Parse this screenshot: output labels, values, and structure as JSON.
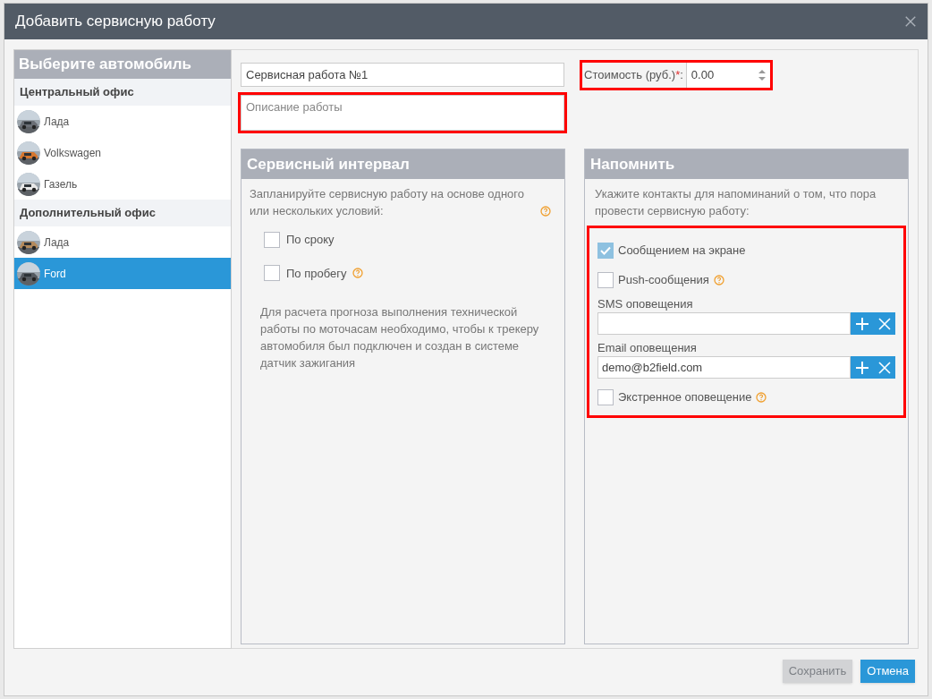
{
  "window": {
    "title": "Добавить сервисную работу"
  },
  "vehicles": {
    "title": "Выберите автомобиль",
    "groups": [
      {
        "name": "Центральный офис",
        "items": [
          {
            "name": "Лада",
            "selected": false,
            "kind": "picture"
          },
          {
            "name": "Volkswagen",
            "selected": false,
            "kind": "picture"
          },
          {
            "name": "Газель",
            "selected": false,
            "kind": "picture"
          }
        ]
      },
      {
        "name": "Дополнительный офис",
        "items": [
          {
            "name": "Лада",
            "selected": false,
            "kind": "picture"
          },
          {
            "name": "Ford",
            "selected": true,
            "kind": "picture"
          }
        ]
      }
    ]
  },
  "name_field": {
    "value": "Сервисная работа №1"
  },
  "description_field": {
    "placeholder": "Описание работы",
    "highlighted": true
  },
  "cost": {
    "label": "Стоимость (руб.)",
    "required_mark": "*",
    "colon": ":",
    "value": "0.00",
    "highlighted": true
  },
  "interval": {
    "title": "Сервисный интервал",
    "intro": "Запланируйте сервисную работу на основе одного или нескольких условий:",
    "options": [
      {
        "label": "По сроку",
        "checked": false,
        "help": false
      },
      {
        "label": "По пробегу",
        "checked": false,
        "help": true
      }
    ],
    "note": "Для расчета прогноза выполнения технической работы по моточасам необходимо, чтобы к трекеру автомобиля был подключен и создан в системе датчик зажигания"
  },
  "remind": {
    "title": "Напомнить",
    "intro": "Укажите контакты для напоминаний о том, что пора провести сервисную работу:",
    "highlighted": true,
    "items": [
      {
        "kind": "checkbox",
        "label": "Сообщением на экране",
        "checked": true,
        "help": false
      },
      {
        "kind": "checkbox",
        "label": "Push-сообщения",
        "checked": false,
        "help": true
      },
      {
        "kind": "field",
        "label": "SMS оповещения"
      },
      {
        "kind": "field",
        "label": "Email оповещения",
        "value": "demo@b2field.com"
      },
      {
        "kind": "checkbox",
        "label": "Экстренное оповещение",
        "checked": false,
        "help": true
      }
    ]
  },
  "buttons": [
    {
      "label": "Сохранить",
      "disabled": true
    },
    {
      "label": "Отмена",
      "disabled": false
    }
  ]
}
